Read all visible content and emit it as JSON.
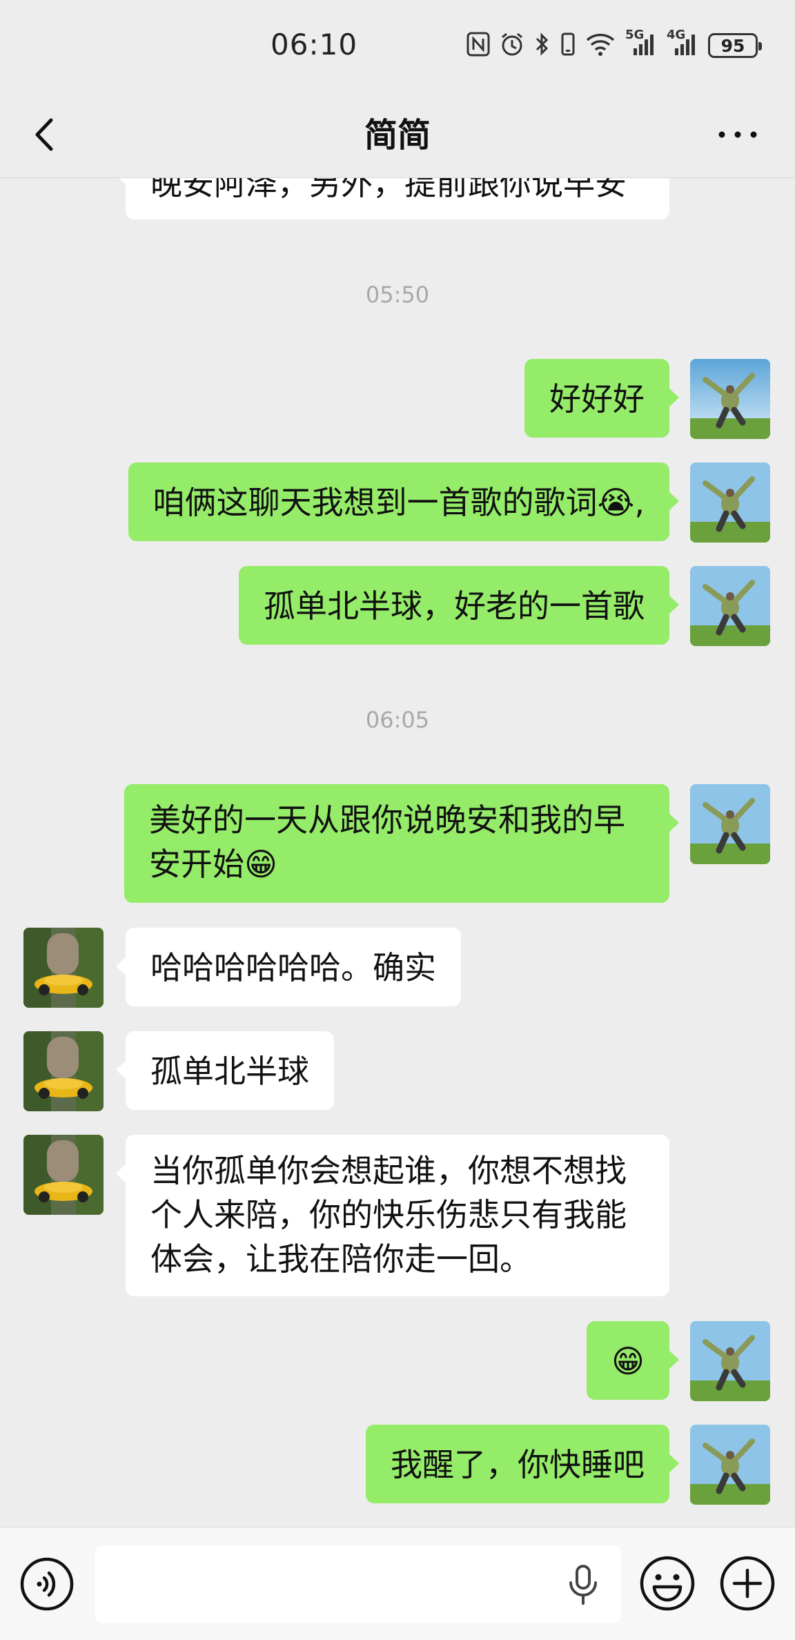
{
  "status_bar": {
    "time": "06:10",
    "signal_label_1": "5G",
    "signal_label_2": "4G",
    "battery": "95",
    "icons": [
      "nfc-icon",
      "alarm-icon",
      "bluetooth-icon",
      "vibrate-icon",
      "wifi-icon",
      "signal-5g-icon",
      "signal-4g-icon",
      "battery-icon"
    ]
  },
  "header": {
    "title": "简简",
    "back_icon": "chevron-left-icon",
    "more_icon": "more-icon"
  },
  "chat": {
    "messages": [
      {
        "from": "them",
        "text": "晚安阿泽，另外，提前跟你说早安"
      },
      {
        "type": "time",
        "text": "05:50"
      },
      {
        "from": "me",
        "text": "好好好"
      },
      {
        "from": "me",
        "text": "咱俩这聊天我想到一首歌的歌词😭,"
      },
      {
        "from": "me",
        "text": "孤单北半球，好老的一首歌"
      },
      {
        "type": "time",
        "text": "06:05"
      },
      {
        "from": "me",
        "text": "美好的一天从跟你说晚安和我的早安开始😁"
      },
      {
        "from": "them",
        "text": "哈哈哈哈哈哈。确实"
      },
      {
        "from": "them",
        "text": "孤单北半球"
      },
      {
        "from": "them",
        "text": "当你孤单你会想起谁，你想不想找个人来陪，你的快乐伤悲只有我能体会，让我在陪你走一回。"
      },
      {
        "from": "me",
        "text": "😁"
      },
      {
        "from": "me",
        "text": "我醒了，你快睡吧"
      }
    ]
  },
  "input_bar": {
    "placeholder": "",
    "icons": [
      "voice-icon",
      "mic-icon",
      "emoji-icon",
      "plus-icon"
    ]
  },
  "colors": {
    "background": "#ededed",
    "my_bubble": "#95ec69",
    "their_bubble": "#ffffff",
    "timestamp": "#a8a8a8"
  }
}
